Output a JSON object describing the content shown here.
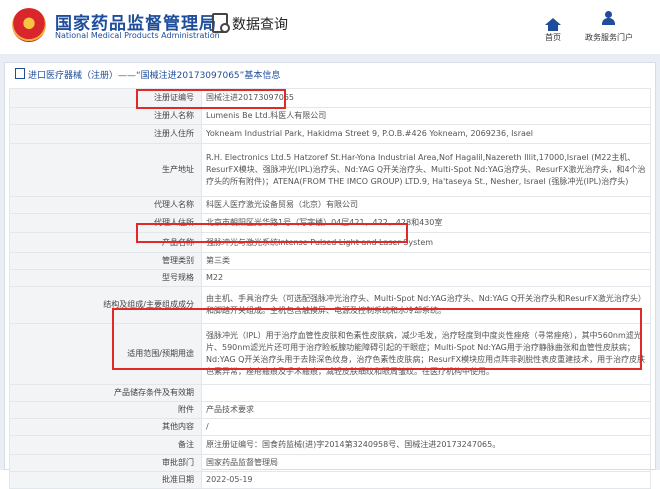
{
  "header": {
    "site_title_cn": "国家药品监督管理局",
    "site_title_en": "National Medical Products Administration",
    "section_title": "数据查询",
    "nav": {
      "home": "首页",
      "portal": "政务服务门户"
    }
  },
  "breadcrumb": "进口医疗器械（注册）——“国械注进20173097065”基本信息",
  "rows": [
    {
      "label": "注册证编号",
      "value": "国械注进20173097065"
    },
    {
      "label": "注册人名称",
      "value": "Lumenis Be Ltd.科医人有限公司"
    },
    {
      "label": "注册人住所",
      "value": "Yokneam Industrial Park, Hakidma Street 9, P.O.B.#426 Yokneam, 2069236, Israel"
    },
    {
      "label": "生产地址",
      "value": "R.H. Electronics Ltd.5 Hatzoref St.Har-Yona Industrial Area,Nof Hagalil,Nazereth Illit,17000,Israel (M22主机、ResurFX模块、强脉冲光(IPL)治疗头、Nd:YAG Q开关治疗头、Multi-Spot Nd:YAG治疗头、ResurFX激光治疗头，和4个治疗头的所有附件)；ATENA(FROM THE IMCO GROUP) LTD.9, Ha'taseya St., Nesher, Israel (强脉冲光(IPL)治疗头)"
    },
    {
      "label": "代理人名称",
      "value": "科医人医疗激光设备贸易（北京）有限公司"
    },
    {
      "label": "代理人住所",
      "value": "北京市朝阳区光华路1号（写字楼）04层421、422、428和430室"
    },
    {
      "label": "产品名称",
      "value": "强脉冲光与激光系统Intense Pulsed Light and Laser System"
    },
    {
      "label": "管理类别",
      "value": "第三类"
    },
    {
      "label": "型号规格",
      "value": "M22"
    },
    {
      "label": "结构及组成/主要组成成分",
      "value": "由主机、手具治疗头（可选配强脉冲光治疗头、Multi-Spot Nd:YAG治疗头、Nd:YAG Q开关治疗头和ResurFX激光治疗头）和脚踏开关组成。主机包含触摸屏、电源及控制系统和水冷却系统。"
    },
    {
      "label": "适用范围/预期用途",
      "value": "强脉冲光（IPL）用于治疗血管性皮肤和色素性皮肤病，减少毛发，治疗轻度到中度炎性痤疮（寻常痤疮），其中560nm滤光片、590nm滤光片还可用于治疗睑板腺功能障碍引起的干眼症；Multi-Spot Nd:YAG用于治疗静脉曲张和血管性皮肤病；Nd:YAG Q开关治疗头用于去除深色纹身，治疗色素性皮肤病；ResurFX模块应用点阵非剥脱性表皮重建技术，用于治疗皮肤色素异常，痤疮瘢痕及手术瘢痕，减轻皮肤细纹和眼周皱纹。在医疗机构中使用。"
    },
    {
      "label": "产品储存条件及有效期",
      "value": ""
    },
    {
      "label": "附件",
      "value": "产品技术要求"
    },
    {
      "label": "其他内容",
      "value": "/"
    },
    {
      "label": "备注",
      "value": "原注册证编号：国食药监械(进)字2014第3240958号、国械注进20173247065。"
    },
    {
      "label": "审批部门",
      "value": "国家药品监督管理局"
    },
    {
      "label": "批准日期",
      "value": "2022-05-19"
    }
  ],
  "colors": {
    "brand": "#1e4d9b",
    "highlight": "#e02a2a"
  }
}
